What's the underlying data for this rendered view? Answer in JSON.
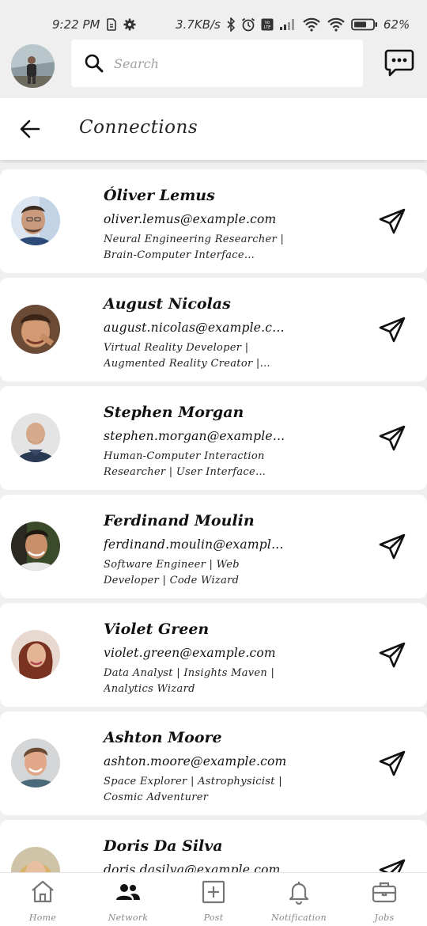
{
  "status_bar": {
    "time": "9:22 PM",
    "network_speed": "3.7KB/s",
    "battery_percent": "62%"
  },
  "search": {
    "placeholder": "Search"
  },
  "header": {
    "title": "Connections"
  },
  "connections": [
    {
      "name": "Óliver Lemus",
      "email": "oliver.lemus@example.com",
      "bio": "Neural Engineering Researcher | Brain-Computer Interface Pioneer"
    },
    {
      "name": "August Nicolas",
      "email": "august.nicolas@example.com",
      "bio": "Virtual Reality Developer | Augmented Reality Creator | Immersive Tech"
    },
    {
      "name": "Stephen Morgan",
      "email": "stephen.morgan@example.com",
      "bio": "Human-Computer Interaction Researcher | User Interface Scientist"
    },
    {
      "name": "Ferdinand Moulin",
      "email": "ferdinand.moulin@example.com",
      "bio": "Software Engineer | Web Developer | Code Wizard"
    },
    {
      "name": "Violet Green",
      "email": "violet.green@example.com",
      "bio": "Data Analyst | Insights Maven | Analytics Wizard"
    },
    {
      "name": "Ashton Moore",
      "email": "ashton.moore@example.com",
      "bio": "Space Explorer | Astrophysicist | Cosmic Adventurer"
    },
    {
      "name": "Doris Da Silva",
      "email": "doris.dasilva@example.com",
      "bio": ""
    }
  ],
  "bottom_nav": [
    {
      "label": "Home",
      "icon": "home-icon"
    },
    {
      "label": "Network",
      "icon": "people-icon",
      "active": true
    },
    {
      "label": "Post",
      "icon": "plus-square-icon"
    },
    {
      "label": "Notification",
      "icon": "bell-icon"
    },
    {
      "label": "Jobs",
      "icon": "briefcase-icon"
    }
  ]
}
